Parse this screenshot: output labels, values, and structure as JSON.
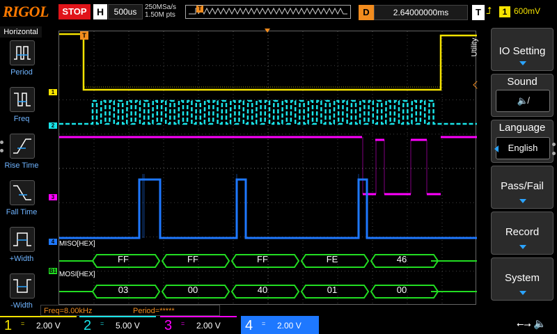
{
  "topbar": {
    "brand": "RIGOL",
    "run_state": "STOP",
    "h_label": "H",
    "timebase": "500us",
    "sample_rate": "250MSa/s",
    "memory_depth": "1.50M pts",
    "trigger_pos_marker": "T",
    "d_label": "D",
    "delay": "2.64000000ms",
    "t_label": "T",
    "trigger_edge_icon": "rising-edge-icon",
    "trigger_channel": "1",
    "trigger_level": "600mV"
  },
  "left_menu": {
    "title": "Horizontal",
    "items": [
      {
        "label": "Period",
        "icon": "period-measure-icon"
      },
      {
        "label": "Freq",
        "icon": "frequency-measure-icon"
      },
      {
        "label": "Rise Time",
        "icon": "rise-time-icon"
      },
      {
        "label": "Fall Time",
        "icon": "fall-time-icon"
      },
      {
        "label": "+Width",
        "icon": "positive-width-icon"
      },
      {
        "label": "-Width",
        "icon": "negative-width-icon"
      }
    ]
  },
  "grid": {
    "channel_markers": [
      "1",
      "2",
      "3",
      "4",
      "B1"
    ],
    "miso_label": "MISO[HEX]",
    "mosi_label": "MOSI[HEX]",
    "miso_values": [
      "FF",
      "FF",
      "FF",
      "FE",
      "46"
    ],
    "mosi_values": [
      "03",
      "00",
      "40",
      "01",
      "00"
    ],
    "trigger_marker": "T"
  },
  "measure": {
    "freq": "Freq=8.00kHz",
    "period": "Period=*****"
  },
  "right_menu": {
    "utility": "Utility",
    "io_setting": "IO Setting",
    "sound": "Sound",
    "sound_icon": "speaker-muted-icon",
    "language": "Language",
    "language_value": "English",
    "pass_fail": "Pass/Fail",
    "record": "Record",
    "system": "System"
  },
  "bottombar": {
    "channels": [
      {
        "num": "1",
        "scale": "2.00 V"
      },
      {
        "num": "2",
        "scale": "5.00 V"
      },
      {
        "num": "3",
        "scale": "2.00 V"
      },
      {
        "num": "4",
        "scale": "2.00 V"
      }
    ],
    "coupling_symbol": "=",
    "usb_icon": "usb-icon",
    "sound_status_icon": "speaker-muted-icon"
  },
  "colors": {
    "ch1": "#f5e300",
    "ch2": "#19e3e8",
    "ch3": "#ff00ff",
    "ch4": "#1e78ff",
    "bus": "#22dd22",
    "accent": "#f28c1e",
    "stop": "#e0141a"
  }
}
